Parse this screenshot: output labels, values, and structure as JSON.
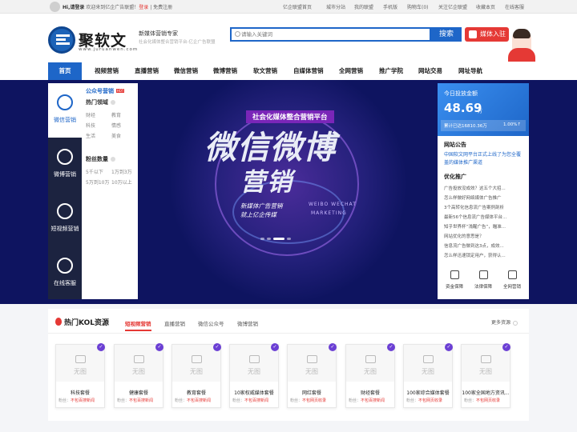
{
  "topbar": {
    "greeting_prefix": "Hi,请登录",
    "greeting_mid": " 欢迎来到亿企广告联盟！",
    "login": "登录",
    "register": "免费注册",
    "links": [
      "亿企联盟首页",
      "城市分站",
      "我的联盟",
      "手机版",
      "购物车(0)",
      "关注亿企联盟",
      "收藏本页",
      "在线客服"
    ]
  },
  "header": {
    "logo_text": "聚软文",
    "logo_url": "www.juruanwen.com",
    "slogan": "新媒体营销专家",
    "subslogan": "社会化媒体整合营销平台-亿企广告联盟",
    "search_placeholder": "请输入关键词",
    "search_button": "搜索",
    "join_button": "媒体入驻"
  },
  "nav": {
    "items": [
      "首页",
      "视频营销",
      "直播营销",
      "微信营销",
      "微博营销",
      "软文营销",
      "自媒体营销",
      "全网营销",
      "推广学院",
      "网站交易",
      "网址导航"
    ]
  },
  "sidebar": {
    "items": [
      "微信营销",
      "微博营销",
      "短视频营销",
      "在线客服"
    ]
  },
  "category_panel": {
    "title": "公众号营销",
    "hot_badge": "HOT",
    "section1": "热门领域",
    "tags1": [
      "财经",
      "教育",
      "科技",
      "情感",
      "生活",
      "美食"
    ],
    "section2": "粉丝数量",
    "tags2": [
      "5千以下",
      "1万到3万",
      "5万到10万",
      "10万以上"
    ]
  },
  "hero": {
    "tagline": "社会化媒体整合营销平台",
    "headline1": "微信微博",
    "headline2": "营销",
    "sub1": "新媒体广告营销",
    "sub2": "就上亿企传媒",
    "en1": "WEIBO WECHAT",
    "en2": "MARKETING"
  },
  "right_panel": {
    "spend_label": "今日投放金额",
    "spend_value": "48.69",
    "spend_unit": "万",
    "total_label": "累计已达16810.36万",
    "growth": "1.00%↑",
    "notice_title": "网站公告",
    "notice_text1": "中国软文网平台正式上线了为您全覆",
    "notice_text2": "盖的媒体推广渠道",
    "promo_title": "优化推广",
    "promo_items": [
      "广告投放没成效？这五个大招...",
      "怎么样做好网络媒体广告推广",
      "3个高转化信息流广告案例剖析",
      "最新56个信息流广告媒体平台...",
      "知乎世界杯“浅醒广告”，瞄准...",
      "网站优化的意思是？",
      "信息流广告做到这3点，成效...",
      "怎么样迅速锁定用户，获得认..."
    ],
    "guarantees": [
      "资金保障",
      "法律保障",
      "全网营销"
    ]
  },
  "kol": {
    "title": "热门KOL资源",
    "tabs": [
      "短视频营销",
      "直播营销",
      "微信公众号",
      "微博营销"
    ],
    "more": "更多资源",
    "no_image": "无图",
    "fans_label": "粉丝：",
    "cards": [
      {
        "name": "科技套餐",
        "fans": "不包百搜新闻"
      },
      {
        "name": "健康套餐",
        "fans": "不包百搜新闻"
      },
      {
        "name": "教育套餐",
        "fans": "不包百搜新闻"
      },
      {
        "name": "10家权威媒体套餐",
        "fans": "不包百搜新闻"
      },
      {
        "name": "网红套餐",
        "fans": "不包网页收录"
      },
      {
        "name": "财经套餐",
        "fans": "不包百搜新闻"
      },
      {
        "name": "100家综合媒体套餐",
        "fans": "不包网页收录"
      },
      {
        "name": "100家全国地方资讯...",
        "fans": "不包网页收录"
      }
    ]
  },
  "colors": {
    "primary": "#1e66c8",
    "accent": "#e53935",
    "hero_bg": "#0e1460",
    "sidebar_bg": "#1c2340"
  }
}
